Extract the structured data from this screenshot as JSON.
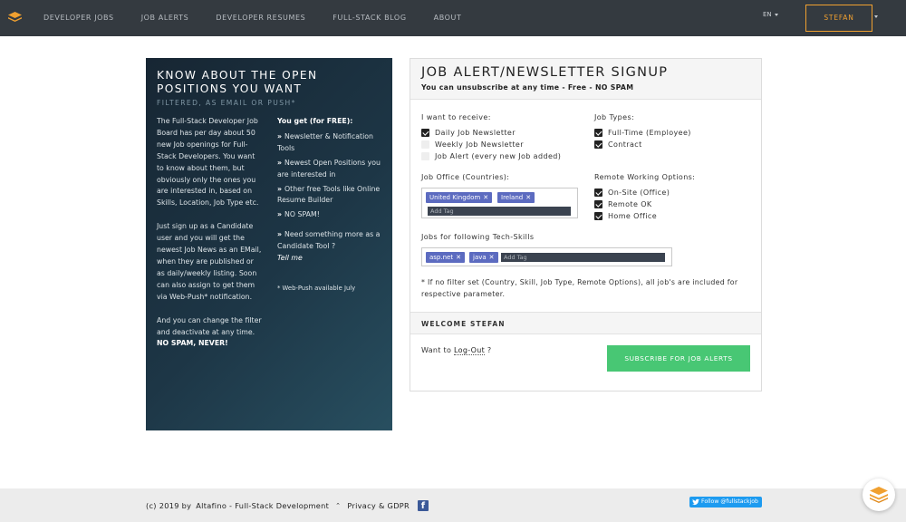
{
  "nav": {
    "links": [
      "Developer Jobs",
      "Job Alerts",
      "Developer Resumes",
      "Full-Stack Blog",
      "About"
    ],
    "lang": "EN",
    "user": "STEFAN",
    "logo_icon": "stack-logo-icon",
    "accent": "#f0a030"
  },
  "promo": {
    "title": "Know about the open positions you want",
    "subtitle": "Filtered, as email or push*",
    "para1": "The Full-Stack Developer Job Board has per day about 50 new Job openings for Full-Stack Developers. You want to know about them, but obviously only the ones you are interested in, based on Skills, Location, Job Type etc.",
    "para2": "Just sign up as a Candidate user and you will get the newest Job News as an EMail, when they are published or as daily/weekly listing. Soon can also assign to get them via Web-Push* notification.",
    "para3": "And you can change the filter and deactivate at any time.",
    "para3_strong": "NO SPAM, NEVER!",
    "you_get": "You get (for FREE):",
    "benefits": [
      "Newsletter & Notification Tools",
      "Newest Open Positions you are interested in",
      "Other free Tools like Online Resume Builder",
      "NO SPAM!"
    ],
    "need_more": "Need something more as a Candidate Tool ?",
    "tell_me": "Tell me",
    "footnote": "* Web-Push available July"
  },
  "signup": {
    "title": "Job Alert/Newsletter Signup",
    "subtitle": "You can unsubscribe at any time - Free - NO SPAM",
    "receive_label": "I want to receive:",
    "receive": [
      {
        "label": "Daily Job Newsletter",
        "checked": true
      },
      {
        "label": "Weekly Job Newsletter",
        "checked": false
      },
      {
        "label": "Job Alert (every new Job added)",
        "checked": false
      }
    ],
    "job_types_label": "Job Types:",
    "job_types": [
      {
        "label": "Full-Time (Employee)",
        "checked": true
      },
      {
        "label": "Contract",
        "checked": true
      }
    ],
    "office_label": "Job Office (Countries):",
    "office_tags": [
      "United Kingdom",
      "Ireland"
    ],
    "office_placeholder": "Add Tag",
    "remote_label": "Remote Working Options:",
    "remote": [
      {
        "label": "On-Site (Office)",
        "checked": true
      },
      {
        "label": "Remote OK",
        "checked": true
      },
      {
        "label": "Home Office",
        "checked": true
      }
    ],
    "skills_label": "Jobs for following Tech-Skills",
    "skill_tags": [
      "asp.net",
      "java"
    ],
    "skills_placeholder": "Add Tag",
    "note": "* If no filter set (Country, Skill, Job Type, Remote Options), all job's are included for respective parameter.",
    "welcome": "Welcome Stefan",
    "logout_prefix": "Want to",
    "logout_link": "Log-Out",
    "logout_suffix": "?",
    "subscribe_label": "Subscribe for Job Alerts",
    "tag_color": "#5c6bc0",
    "button_color": "#48c774"
  },
  "footer": {
    "copyright": "(c) 2019 by",
    "company": "Altafino - Full-Stack Development",
    "privacy": "Privacy & GDPR",
    "twitter": "Follow @fullstackjob"
  }
}
